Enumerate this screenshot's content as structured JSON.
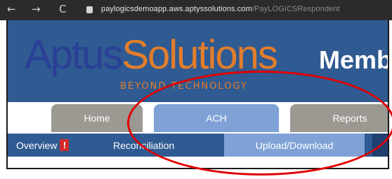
{
  "browser": {
    "back_icon": "←",
    "forward_icon": "→",
    "reload_icon": "C",
    "url_main": "paylogicsdemoapp.aws.aptyssolutions.com",
    "url_rest": "/PayLOGICSRespondent"
  },
  "header": {
    "logo_aptus": "Aptus",
    "logo_solutions": "Solutions",
    "logo_tagline": "BEYOND TECHNOLOGY",
    "title": "Memb"
  },
  "tabs": [
    {
      "label": "Home"
    },
    {
      "label": "ACH"
    },
    {
      "label": "Reports"
    }
  ],
  "subnav": {
    "overview": "Overview",
    "overview_badge": "!",
    "reconciliation": "Reconciliation",
    "upload_download": "Upload/Download"
  },
  "colors": {
    "header_bg": "#2f5a92",
    "tab_active": "#7fa1d6",
    "tab_inactive": "#9c9892",
    "logo_blue": "#2a3f96",
    "logo_orange": "#e27e2c",
    "annotation": "#e00000"
  }
}
